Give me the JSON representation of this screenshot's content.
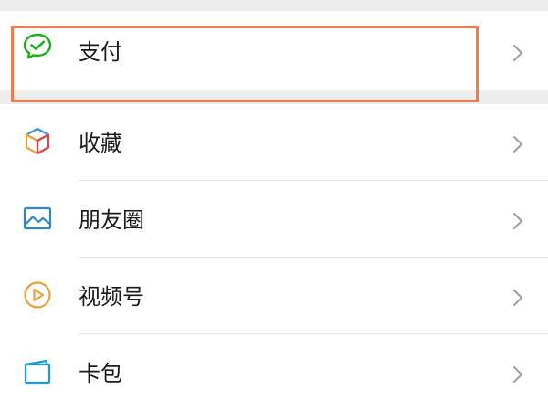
{
  "menu": {
    "pay": {
      "label": "支付",
      "icon": "wechat-pay-icon"
    },
    "items": [
      {
        "label": "收藏",
        "icon": "favorites-cube-icon"
      },
      {
        "label": "朋友圈",
        "icon": "moments-picture-icon"
      },
      {
        "label": "视频号",
        "icon": "channels-play-icon"
      },
      {
        "label": "卡包",
        "icon": "card-wallet-icon"
      }
    ]
  },
  "colors": {
    "highlight": "#f07a4f",
    "pay_green": "#1aad19",
    "moments_blue": "#2f86c9",
    "channels_orange": "#e9a23b",
    "card_teal": "#1c9bd1"
  }
}
